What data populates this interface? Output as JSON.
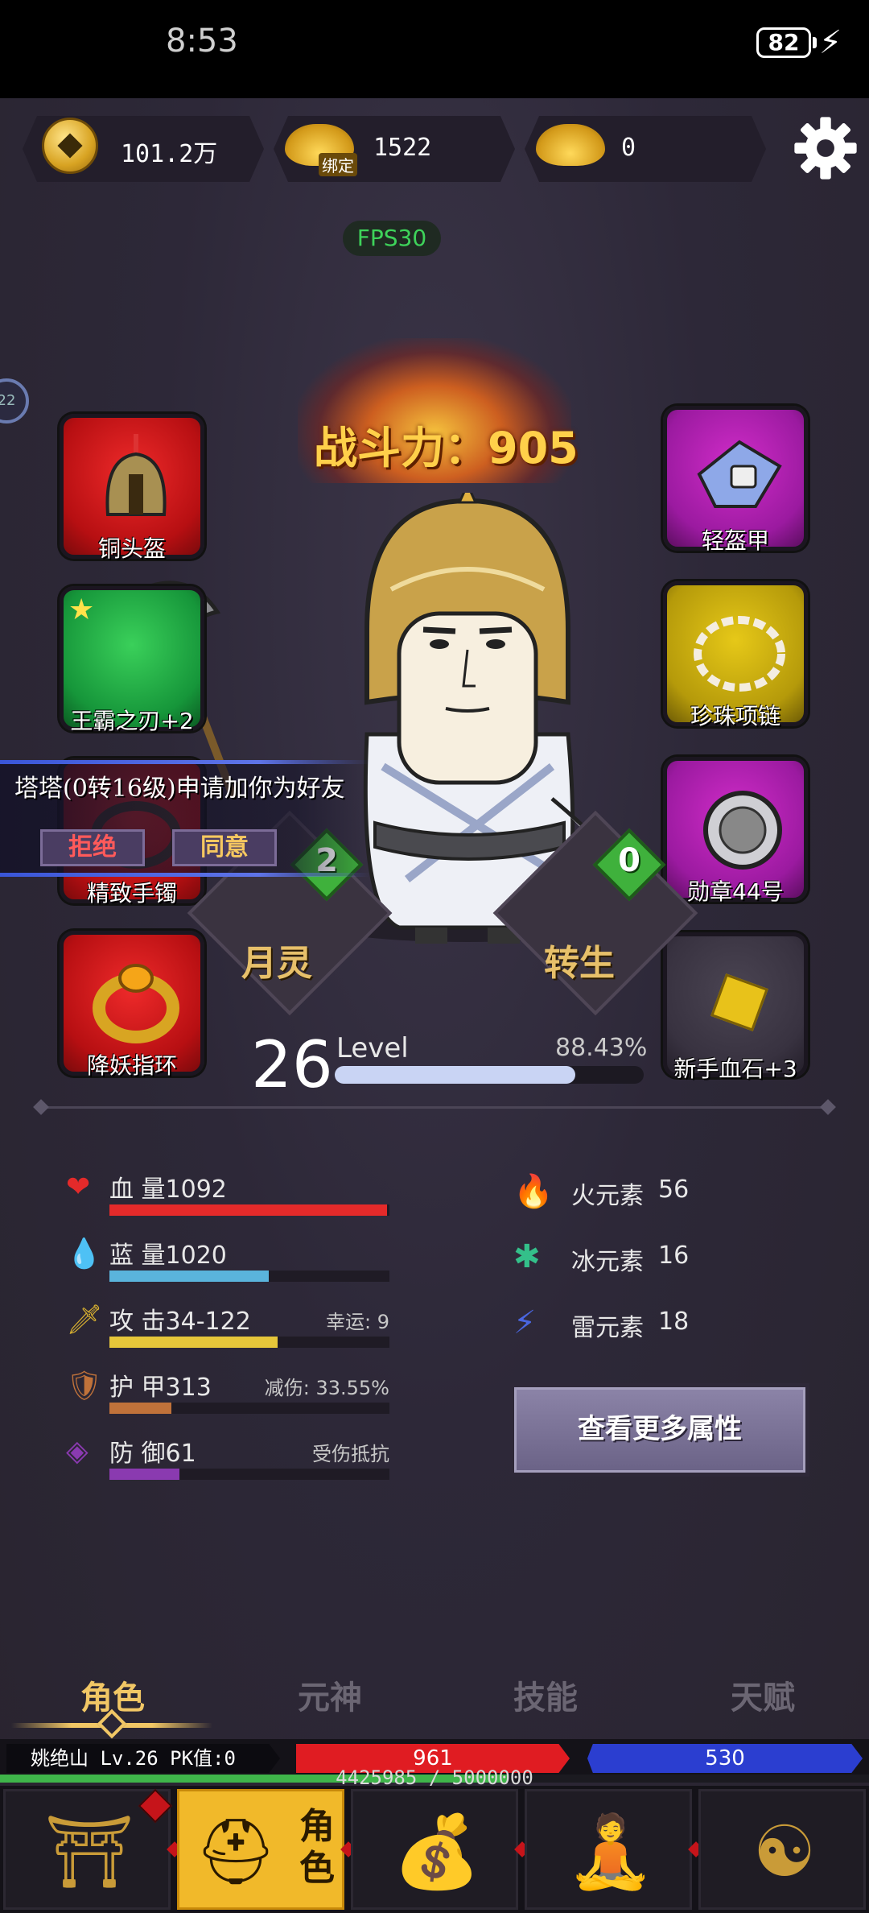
{
  "status_bar": {
    "time": "8:53",
    "battery": "82"
  },
  "currencies": [
    {
      "icon": "copper-coin-icon",
      "value": "101.2万"
    },
    {
      "icon": "bound-gold-ingot-icon",
      "tag": "绑定",
      "value": "1522"
    },
    {
      "icon": "gold-ingot-icon",
      "value": "0"
    }
  ],
  "fps": "FPS30",
  "side_badge": "22",
  "combat_power": {
    "label": "战斗力",
    "value": "905"
  },
  "equipment_left": [
    {
      "label": "铜头盔",
      "icon": "bronze-helmet-icon",
      "rarity": "red"
    },
    {
      "label": "王霸之刃+2",
      "icon": "axe-blade-icon",
      "rarity": "green"
    },
    {
      "label": "精致手镯",
      "icon": "bracelet-icon",
      "rarity": "red"
    },
    {
      "label": "降妖指环",
      "icon": "ring-icon",
      "rarity": "red"
    }
  ],
  "equipment_right": [
    {
      "label": "轻盔甲",
      "icon": "light-armor-icon",
      "rarity": "purple"
    },
    {
      "label": "珍珠项链",
      "icon": "pearl-necklace-icon",
      "rarity": "gold"
    },
    {
      "label": "勋章44号",
      "icon": "medal-icon",
      "rarity": "purple"
    },
    {
      "label": "新手血石+3",
      "icon": "blood-stone-icon",
      "rarity": "dark"
    }
  ],
  "spirit": {
    "label": "月灵",
    "count": "2"
  },
  "rebirth": {
    "label": "转生",
    "count": "0"
  },
  "notification": {
    "text": "塔塔(0转16级)申请加你为好友",
    "reject": "拒绝",
    "accept": "同意"
  },
  "level": {
    "number": "26",
    "word": "Level",
    "percent": "88.43%",
    "progress": 0.8843
  },
  "stats": [
    {
      "icon": "heart-icon",
      "name": "血 量1092",
      "extra": "",
      "color": "#e42a2a",
      "fill": 0.99
    },
    {
      "icon": "water-drop-icon",
      "name": "蓝 量1020",
      "extra": "",
      "color": "#5ab4dc",
      "fill": 0.57
    },
    {
      "icon": "sword-icon",
      "name": "攻 击34-122",
      "extra": "幸运: 9",
      "color": "#e6c63a",
      "fill": 0.6
    },
    {
      "icon": "shield-icon",
      "name": "护 甲313",
      "extra": "减伤: 33.55%",
      "color": "#c0723a",
      "fill": 0.22
    },
    {
      "icon": "defense-emblem-icon",
      "name": "防 御61",
      "extra": "受伤抵抗",
      "color": "#8a3ab0",
      "fill": 0.25
    }
  ],
  "elements": [
    {
      "icon": "fire-icon",
      "name": "火元素",
      "value": "56",
      "color": "#e23a2a"
    },
    {
      "icon": "ice-icon",
      "name": "冰元素",
      "value": "16",
      "color": "#34c08a"
    },
    {
      "icon": "lightning-icon",
      "name": "雷元素",
      "value": "18",
      "color": "#4a66e0"
    }
  ],
  "more_button": "查看更多属性",
  "tabs": [
    {
      "label": "角色",
      "active": true
    },
    {
      "label": "元神",
      "active": false
    },
    {
      "label": "技能",
      "active": false
    },
    {
      "label": "天赋",
      "active": false
    }
  ],
  "player_bar": {
    "name": "姚绝山",
    "level": "Lv.26",
    "pk": "PK值:0",
    "hp": "961",
    "mp": "530",
    "exp_text": "4425985 / 5000000",
    "exp_progress": 0.885
  },
  "bottom_nav": [
    {
      "icon": "town-gate-icon",
      "label": "",
      "active": false
    },
    {
      "icon": "character-helmet-icon",
      "label": "角色",
      "active": true
    },
    {
      "icon": "money-bag-icon",
      "label": "",
      "active": false
    },
    {
      "icon": "meditation-icon",
      "label": "",
      "active": false
    },
    {
      "icon": "taoist-totem-icon",
      "label": "",
      "active": false
    }
  ]
}
